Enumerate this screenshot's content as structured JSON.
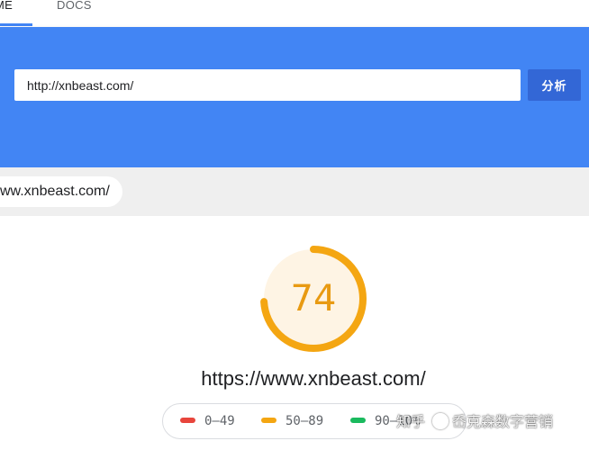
{
  "tabs": [
    {
      "label": "ME",
      "active": true
    },
    {
      "label": "DOCS",
      "active": false
    }
  ],
  "search": {
    "value": "http://xnbeast.com/",
    "button_label": "分析"
  },
  "report": {
    "url_chip": "ww.xnbeast.com/",
    "score": 74,
    "score_fraction": 0.74,
    "score_color": "#e89a12",
    "url": "https://www.xnbeast.com/"
  },
  "legend": [
    {
      "label": "0–49",
      "color": "#e8453c"
    },
    {
      "label": "50–89",
      "color": "#f4a612"
    },
    {
      "label": "90–10%",
      "color": "#1aba5e"
    }
  ],
  "watermark": {
    "text_left": "知乎",
    "text_right": "岙克森数字营销"
  },
  "colors": {
    "brand_blue": "#4285f4",
    "button_blue": "#3367d6"
  }
}
